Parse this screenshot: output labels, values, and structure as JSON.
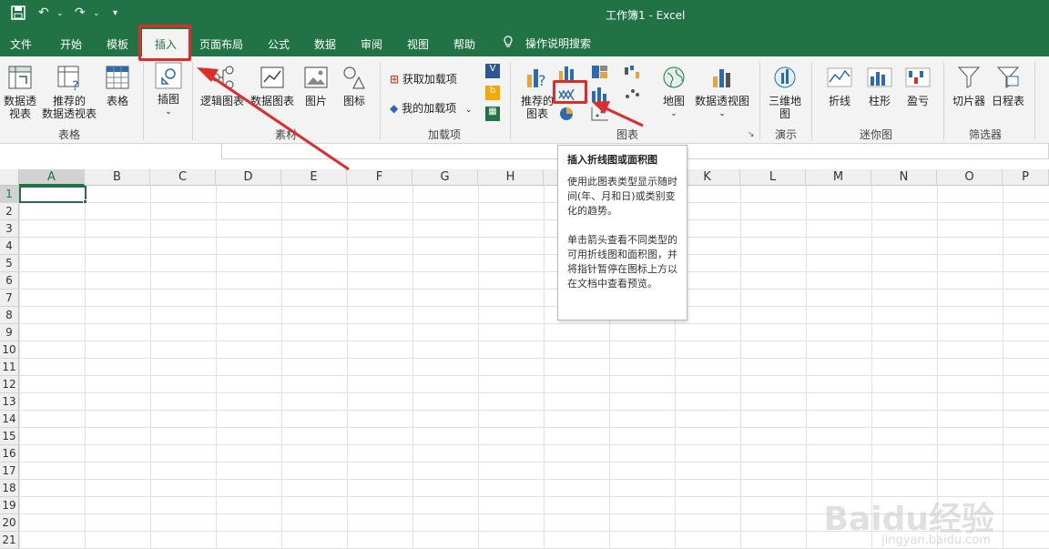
{
  "window": {
    "title": "工作簿1  -  Excel"
  },
  "tabs": [
    "文件",
    "开始",
    "模板",
    "插入",
    "页面布局",
    "公式",
    "数据",
    "审阅",
    "视图",
    "帮助"
  ],
  "active_tab": "插入",
  "tell_me": "操作说明搜索",
  "ribbon": {
    "tables": {
      "pivot": "数据透\n视表",
      "recommended_pivot": "推荐的\n数据透视表",
      "table": "表格",
      "group": "表格"
    },
    "illustrations": {
      "button": "插图",
      "group": ""
    },
    "material": {
      "logic": "逻辑图表",
      "data_chart": "数据图表",
      "picture": "图片",
      "icon": "图标",
      "group": "素材"
    },
    "addins": {
      "get": "获取加载项",
      "mine": "我的加载项",
      "group": "加载项"
    },
    "charts": {
      "recommended": "推荐的\n图表",
      "map": "地图",
      "pivot_chart": "数据透视图",
      "group": "图表"
    },
    "tours": {
      "3dmap": "三维地\n图",
      "group": "演示"
    },
    "sparklines": {
      "line": "折线",
      "column": "柱形",
      "winloss": "盈亏",
      "group": "迷你图"
    },
    "filters": {
      "slicer": "切片器",
      "timeline": "日程表",
      "group": "筛选器"
    }
  },
  "columns": [
    "A",
    "B",
    "C",
    "D",
    "E",
    "F",
    "G",
    "H",
    "I",
    "J",
    "K",
    "L",
    "M",
    "N",
    "O",
    "P"
  ],
  "rows": [
    "1",
    "2",
    "3",
    "4",
    "5",
    "6",
    "7",
    "8",
    "9",
    "10",
    "11",
    "12",
    "13",
    "14",
    "15",
    "16",
    "17",
    "18",
    "19",
    "20",
    "21"
  ],
  "tooltip": {
    "title": "插入折线图或面积图",
    "p1": "使用此图表类型显示随时间(年、月和日)或类别变化的趋势。",
    "p2": "单击箭头查看不同类型的可用折线图和面积图，并将指针暂停在图标上方以在文档中查看预览。"
  },
  "watermark": {
    "main": "Baidu经验",
    "sub": "jingyan.baidu.com"
  },
  "colors": {
    "excel_green": "#217346",
    "highlight_red": "#e02b2b"
  }
}
